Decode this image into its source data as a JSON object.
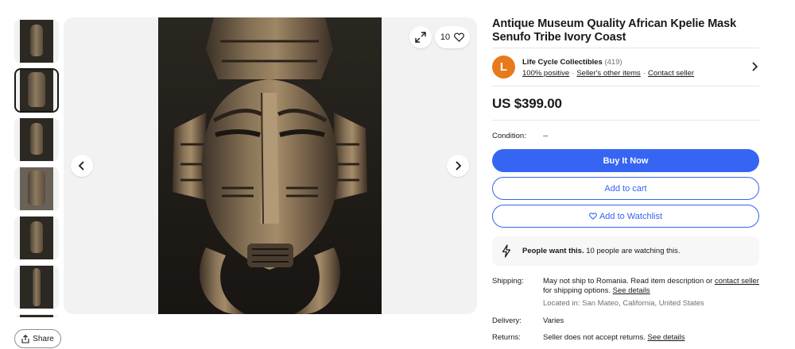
{
  "gallery": {
    "watch_count": "10",
    "thumbnail_count": 7,
    "active_thumbnail": 1
  },
  "share": {
    "label": "Share"
  },
  "listing": {
    "title": "Antique Museum Quality African Kpelie Mask Senufo Tribe Ivory Coast",
    "price": "US $399.00",
    "condition_label": "Condition:",
    "condition_value": "--"
  },
  "seller": {
    "initial": "L",
    "name": "Life Cycle Collectibles",
    "feedback_count": "(419)",
    "positive": "100% positive",
    "other_items": "Seller's other items",
    "contact": "Contact seller",
    "avatar_color": "#e87a1e"
  },
  "actions": {
    "buy_now": "Buy It Now",
    "add_to_cart": "Add to cart",
    "add_to_watchlist": "Add to Watchlist",
    "accent_color": "#3665f3"
  },
  "signal": {
    "strong": "People want this.",
    "text": "10 people are watching this."
  },
  "shipping": {
    "label": "Shipping:",
    "text_1": "May not ship to Romania. Read item description or ",
    "contact_link": "contact seller",
    "text_2": " for shipping options. ",
    "details_link": "See details",
    "location": "Located in: San Mateo, California, United States"
  },
  "delivery": {
    "label": "Delivery:",
    "value": "Varies"
  },
  "returns": {
    "label": "Returns:",
    "value": "Seller does not accept returns. ",
    "details_link": "See details"
  }
}
